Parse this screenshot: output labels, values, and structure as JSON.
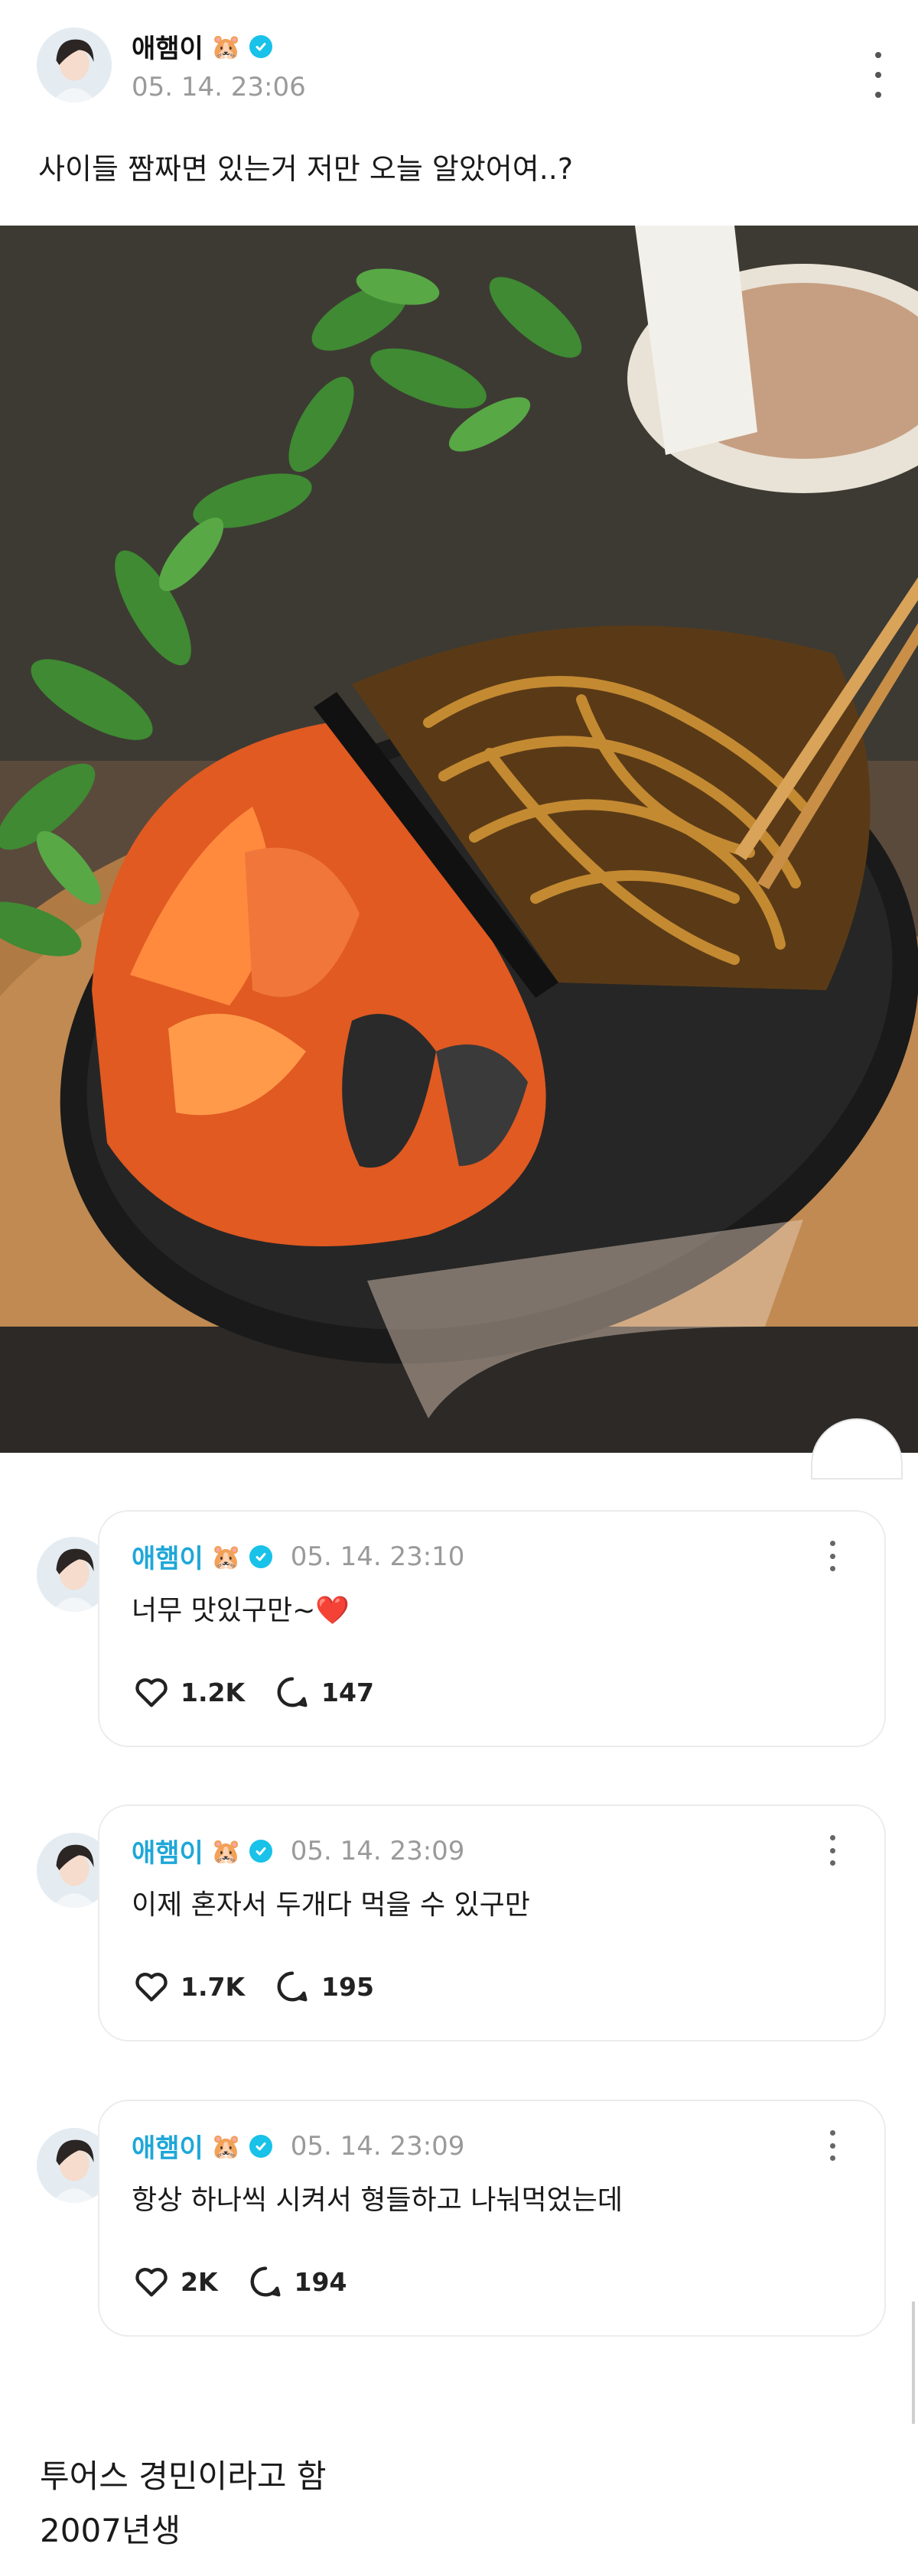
{
  "post": {
    "username": "애햄이",
    "username_emoji": "🐹",
    "timestamp": "05. 14. 23:06",
    "text": "사이들 짬짜면 있는거 저만 오늘 알았어여..?"
  },
  "replies": [
    {
      "username": "애햄이",
      "username_emoji": "🐹",
      "timestamp": "05. 14. 23:10",
      "text": "너무 맛있구만~❤️",
      "likes": "1.2K",
      "comments": "147"
    },
    {
      "username": "애햄이",
      "username_emoji": "🐹",
      "timestamp": "05. 14. 23:09",
      "text": "이제 혼자서 두개다 먹을 수 있구만",
      "likes": "1.7K",
      "comments": "195"
    },
    {
      "username": "애햄이",
      "username_emoji": "🐹",
      "timestamp": "05. 14. 23:09",
      "text": "항상 하나씩 시켜서 형들하고 나눠먹었는데",
      "likes": "2K",
      "comments": "194"
    }
  ],
  "caption": {
    "line1": "투어스 경민이라고 함",
    "line2": "2007년생"
  },
  "colors": {
    "verified": "#18c2e8",
    "reply_username": "#1ea7d8",
    "timestamp": "#9a9a9a"
  },
  "icons": [
    "verified-badge-icon",
    "more-options-icon",
    "heart-icon",
    "comment-icon"
  ]
}
